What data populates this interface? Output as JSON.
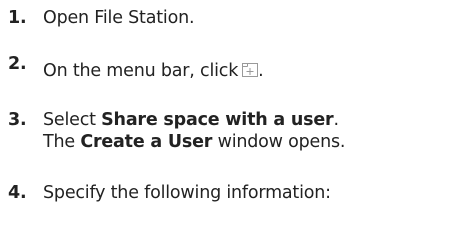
{
  "steps": [
    {
      "number": "1.",
      "text": "Open File Station."
    },
    {
      "number": "2.",
      "text_before": "On the menu bar, click",
      "icon": "create-folder-plus-icon",
      "text_after": "."
    },
    {
      "number": "3.",
      "text_before": "Select ",
      "bold": "Share space with a user",
      "text_after": ".",
      "line2_before": "The ",
      "line2_bold": "Create a User",
      "line2_after": " window opens."
    },
    {
      "number": "4.",
      "text": "Specify the following information:"
    }
  ],
  "colors": {
    "text": "#222222",
    "icon_stroke": "#9a9a9a"
  }
}
